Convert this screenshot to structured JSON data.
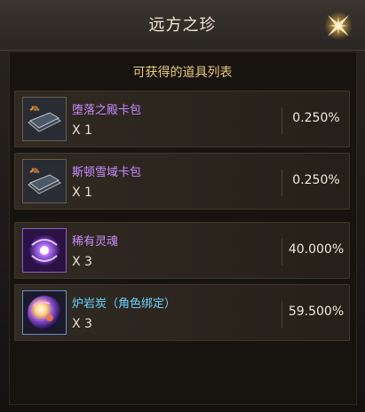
{
  "window": {
    "title": "远方之珍"
  },
  "panel": {
    "subtitle": "可获得的道具列表"
  },
  "colors": {
    "purple_name": "#c98cff",
    "cyan_name": "#69d3ff",
    "gold_subtitle": "#e8c87a"
  },
  "items": [
    {
      "name": "堕落之殿卡包",
      "quantity": "X 1",
      "probability": "0.250%",
      "name_color": "#c98cff",
      "icon": "card-pack-icon"
    },
    {
      "name": "斯顿雪域卡包",
      "quantity": "X 1",
      "probability": "0.250%",
      "name_color": "#c98cff",
      "icon": "card-pack-icon"
    },
    {
      "name": "稀有灵魂",
      "quantity": "X 3",
      "probability": "40.000%",
      "name_color": "#c98cff",
      "icon": "rare-soul-icon"
    },
    {
      "name": "炉岩炭（角色绑定）",
      "quantity": "X 3",
      "probability": "59.500%",
      "name_color": "#69d3ff",
      "icon": "lava-charcoal-icon"
    }
  ]
}
